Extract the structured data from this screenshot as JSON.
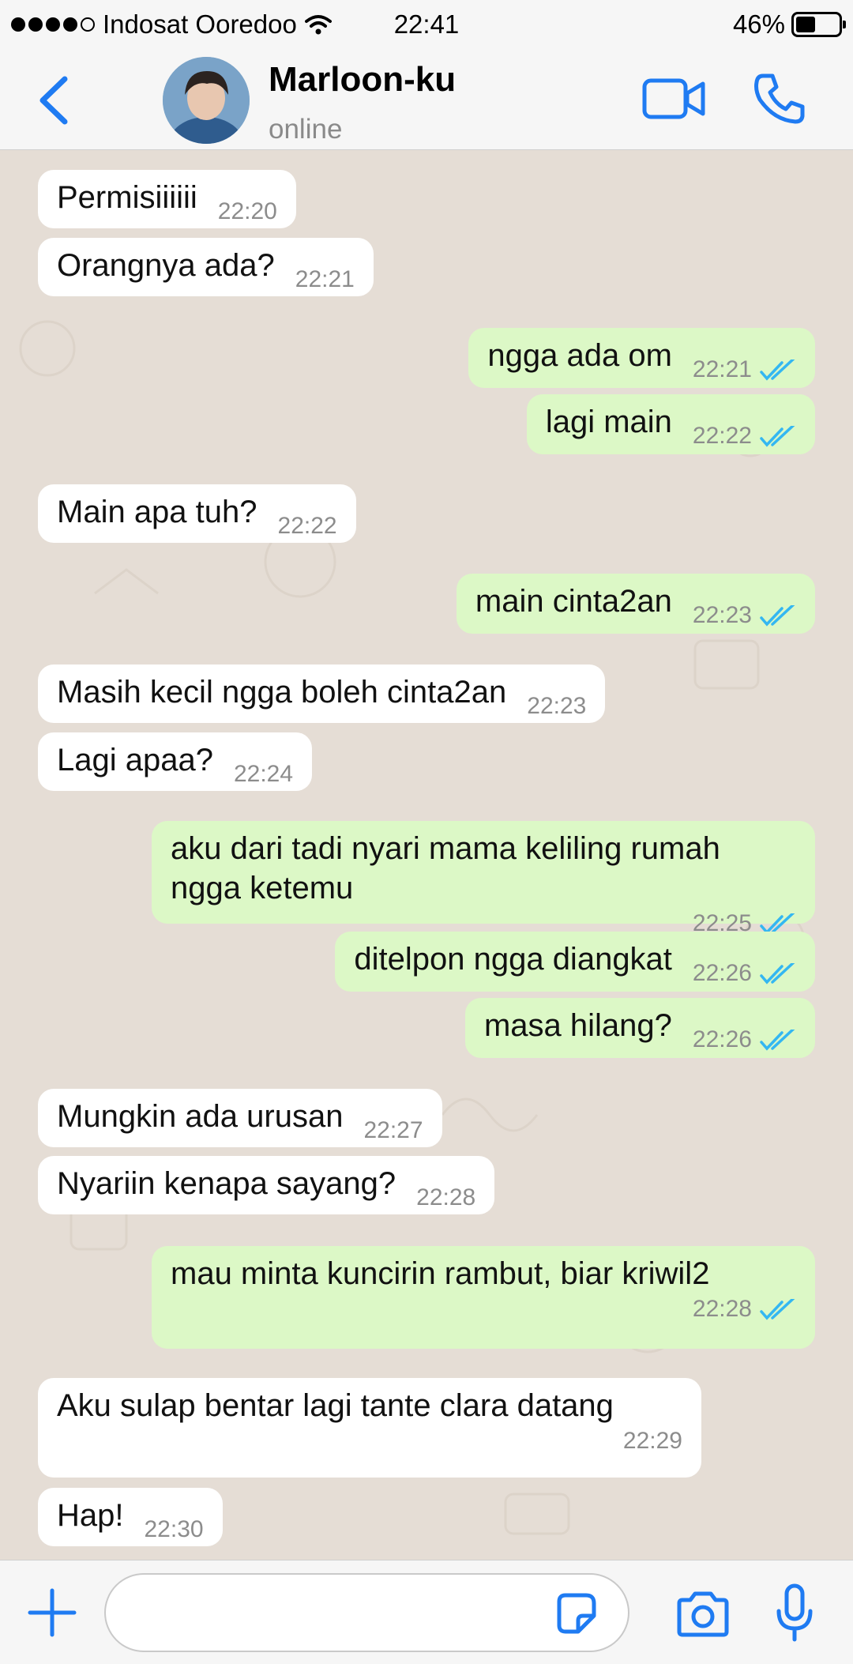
{
  "status_bar": {
    "carrier": "Indosat Ooredoo",
    "time": "22:41",
    "battery": "46%",
    "battery_level": 0.46
  },
  "header": {
    "back_icon": "chevron-left-icon",
    "name": "Marloon-ku",
    "status": "online",
    "video_icon": "video-call-icon",
    "phone_icon": "phone-icon"
  },
  "messages": [
    {
      "side": "in",
      "text": "Permisiiiiii",
      "time": "22:20"
    },
    {
      "side": "in",
      "text": "Orangnya ada?",
      "time": "22:21"
    },
    {
      "side": "out",
      "text": "ngga ada om",
      "time": "22:21"
    },
    {
      "side": "out",
      "text": "lagi main",
      "time": "22:22"
    },
    {
      "side": "in",
      "text": "Main apa tuh?",
      "time": "22:22"
    },
    {
      "side": "out",
      "text": "main cinta2an",
      "time": "22:23"
    },
    {
      "side": "in",
      "text": "Masih kecil ngga boleh cinta2an",
      "time": "22:23"
    },
    {
      "side": "in",
      "text": "Lagi apaa?",
      "time": "22:24"
    },
    {
      "side": "out",
      "text": "aku dari tadi nyari mama keliling rumah ngga ketemu",
      "time": "22:25"
    },
    {
      "side": "out",
      "text": "ditelpon ngga diangkat",
      "time": "22:26"
    },
    {
      "side": "out",
      "text": "masa hilang?",
      "time": "22:26"
    },
    {
      "side": "in",
      "text": "Mungkin ada urusan",
      "time": "22:27"
    },
    {
      "side": "in",
      "text": "Nyariin kenapa sayang?",
      "time": "22:28"
    },
    {
      "side": "out",
      "text": "mau minta kuncirin rambut, biar kriwil2",
      "time": "22:28"
    },
    {
      "side": "in",
      "text": "Aku sulap bentar lagi tante clara datang",
      "time": "22:29"
    },
    {
      "side": "in",
      "text": "Hap!",
      "time": "22:30"
    }
  ],
  "input_bar": {
    "placeholder": "",
    "icons": [
      "plus-icon",
      "sticker-icon",
      "camera-icon",
      "microphone-icon"
    ]
  },
  "colors": {
    "accent": "#1f7bf2",
    "incoming_bubble": "#ffffff",
    "outgoing_bubble": "#dcf8c6",
    "read_ticks": "#34b7f1",
    "chat_background": "#e5ddd5"
  }
}
